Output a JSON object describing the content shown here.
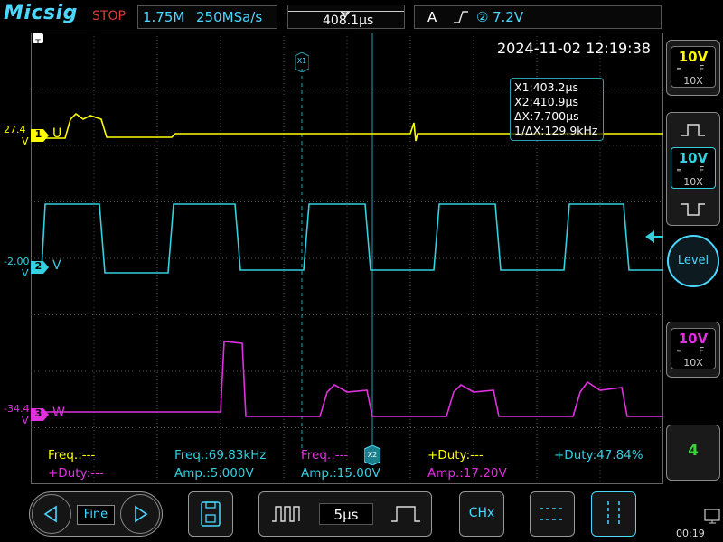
{
  "header": {
    "brand": "Micsig",
    "run_state": "STOP",
    "record_length": "1.75M",
    "sample_rate": "250MSa/s",
    "trigger_position": "408.1µs",
    "trigger_mode": "A",
    "trigger_source": "②",
    "trigger_level": "7.2V"
  },
  "screen": {
    "timestamp": "2024-11-02 12:19:38"
  },
  "cursor_readout": {
    "x1": "X1:403.2µs",
    "x2": "X2:410.9µs",
    "dx": "ΔX:7.700µs",
    "inv_dx": "1/ΔX:129.9kHz",
    "x1_tag": "X1",
    "x2_tag": "X2"
  },
  "channels": [
    {
      "id": "1",
      "label": "U",
      "offset": "27.4",
      "unit": "V",
      "color": "#ffff00",
      "scale": "10V",
      "probe": "10X",
      "coupling": "DC"
    },
    {
      "id": "2",
      "label": "V",
      "offset": "-2.00",
      "unit": "V",
      "color": "#33d0e0",
      "scale": "10V",
      "probe": "10X",
      "coupling": "DC"
    },
    {
      "id": "3",
      "label": "W",
      "offset": "-34.4",
      "unit": "V",
      "color": "#e030e0",
      "scale": "10V",
      "probe": "10X",
      "coupling": "DC"
    }
  ],
  "trigger_level_button": "Level",
  "counter_button": "4",
  "measurements": {
    "row1": [
      {
        "text": "Freq.:---",
        "color": "#ffff00"
      },
      {
        "text": "Freq.:69.83kHz",
        "color": "#33d0e0"
      },
      {
        "text": "Freq.:---",
        "color": "#e030e0"
      },
      {
        "text": "+Duty:---",
        "color": "#ffff00"
      },
      {
        "text": "+Duty:47.84%",
        "color": "#33d0e0"
      }
    ],
    "row2": [
      {
        "text": "+Duty:---",
        "color": "#e030e0"
      },
      {
        "text": "Amp.:5.000V",
        "color": "#33d0e0"
      },
      {
        "text": "Amp.:15.00V",
        "color": "#33d0e0"
      },
      {
        "text": "Amp.:17.20V",
        "color": "#e030e0"
      }
    ]
  },
  "bottombar": {
    "fine_label": "Fine",
    "timebase": "5µs",
    "chx_label": "CHx",
    "clock": "00:19"
  }
}
